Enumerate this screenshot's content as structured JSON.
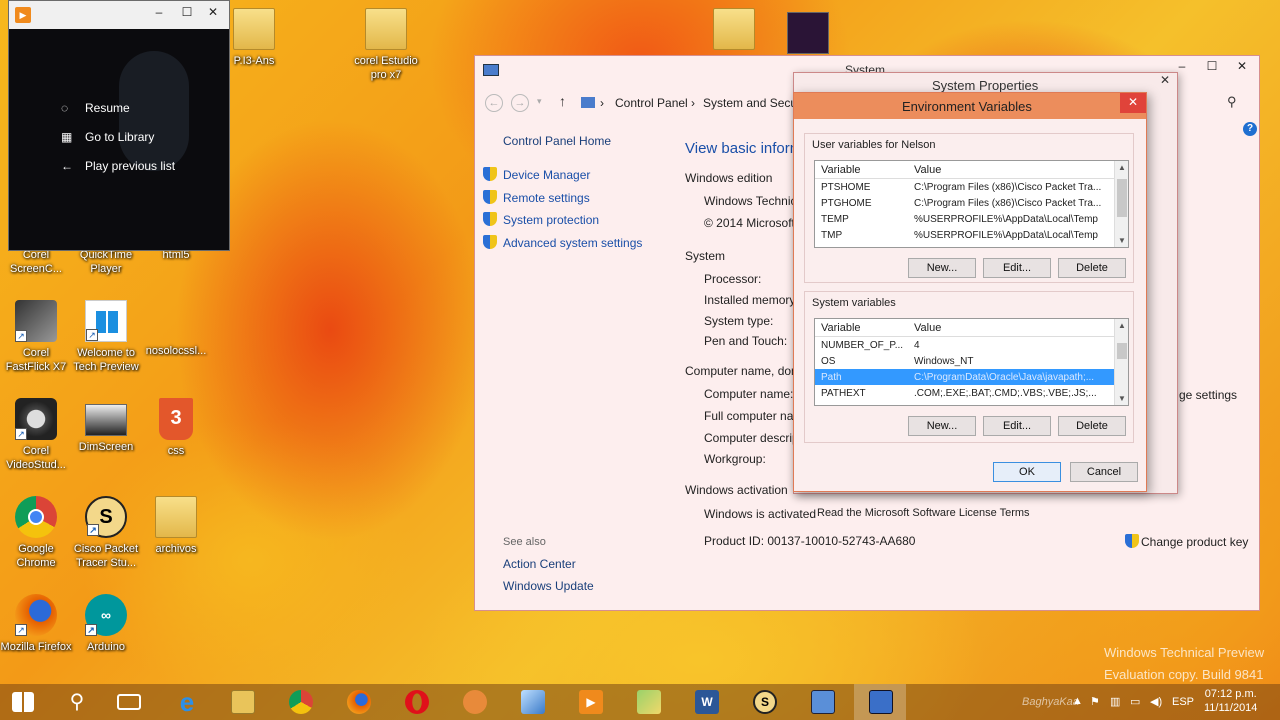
{
  "media_player": {
    "menu": [
      {
        "icon": "resume-icon",
        "label": "Resume"
      },
      {
        "icon": "library-icon",
        "label": "Go to Library"
      },
      {
        "icon": "back-arrow-icon",
        "label": "Play previous list"
      }
    ]
  },
  "desktop": {
    "icons": [
      {
        "name": "desktop-icon-p13-ans",
        "label": "P.I3-Ans"
      },
      {
        "name": "desktop-icon-corel-estudio",
        "label": "corel Estudio pro x7"
      },
      {
        "name": "desktop-icon-corel-screencap",
        "label": "Corel ScreenC..."
      },
      {
        "name": "desktop-icon-quicktime",
        "label": "QuickTime Player"
      },
      {
        "name": "desktop-icon-html5",
        "label": "html5"
      },
      {
        "name": "desktop-icon-corel-fastflick",
        "label": "Corel FastFlick X7"
      },
      {
        "name": "desktop-icon-welcome-tech-preview",
        "label": "Welcome to Tech Preview"
      },
      {
        "name": "desktop-icon-nosolocssl",
        "label": "nosolocssl..."
      },
      {
        "name": "desktop-icon-corel-videostudio",
        "label": "Corel VideoStud..."
      },
      {
        "name": "desktop-icon-dimscreen",
        "label": "DimScreen"
      },
      {
        "name": "desktop-icon-css",
        "label": "css"
      },
      {
        "name": "desktop-icon-google-chrome",
        "label": "Google Chrome"
      },
      {
        "name": "desktop-icon-cisco-packet-tracer",
        "label": "Cisco Packet Tracer Stu..."
      },
      {
        "name": "desktop-icon-archivos",
        "label": "archivos"
      },
      {
        "name": "desktop-icon-mozilla-firefox",
        "label": "Mozilla Firefox"
      },
      {
        "name": "desktop-icon-arduino",
        "label": "Arduino"
      }
    ]
  },
  "system_window": {
    "title": "System",
    "breadcrumb": [
      "Control Panel",
      "System and Securi"
    ],
    "left_nav": {
      "home": "Control Panel Home",
      "links": [
        "Device Manager",
        "Remote settings",
        "System protection",
        "Advanced system settings"
      ],
      "see_also": "See also",
      "see_also_links": [
        "Action Center",
        "Windows Update"
      ]
    },
    "heading": "View basic inform",
    "sections": {
      "edition": "Windows edition",
      "edition_name": "Windows Technica",
      "copyright": "© 2014 Microsoft",
      "system": "System",
      "processor": "Processor:",
      "memory": "Installed memory",
      "system_type": "System type:",
      "pen_touch": "Pen and Touch:",
      "computer_name_section": "Computer name, dom",
      "computer_name": "Computer name:",
      "full_computer_name": "Full computer nan",
      "computer_desc": "Computer descrip",
      "workgroup": "Workgroup:",
      "change_settings": "ge settings",
      "activation": "Windows activation",
      "activated": "Windows is activated",
      "license_link": "Read the Microsoft Software License Terms",
      "product_id": "Product ID: 00137-10010-52743-AA680",
      "change_key": "Change product key"
    },
    "watermark": [
      "Windows Technical Preview",
      "Evaluation copy. Build 9841"
    ]
  },
  "system_properties": {
    "title": "System Properties"
  },
  "env_dialog": {
    "title": "Environment Variables",
    "user_group_label": "User variables for Nelson",
    "system_group_label": "System variables",
    "col_variable": "Variable",
    "col_value": "Value",
    "user_vars": [
      {
        "name": "PTSHOME",
        "value": "C:\\Program Files (x86)\\Cisco Packet Tra..."
      },
      {
        "name": "PTGHOME",
        "value": "C:\\Program Files (x86)\\Cisco Packet Tra..."
      },
      {
        "name": "TEMP",
        "value": "%USERPROFILE%\\AppData\\Local\\Temp"
      },
      {
        "name": "TMP",
        "value": "%USERPROFILE%\\AppData\\Local\\Temp"
      }
    ],
    "system_vars": [
      {
        "name": "NUMBER_OF_P...",
        "value": "4"
      },
      {
        "name": "OS",
        "value": "Windows_NT"
      },
      {
        "name": "Path",
        "value": "C:\\ProgramData\\Oracle\\Java\\javapath;..."
      },
      {
        "name": "PATHEXT",
        "value": ".COM;.EXE;.BAT;.CMD;.VBS;.VBE;.JS;..."
      }
    ],
    "selected_system_var": "Path",
    "new_label": "New...",
    "edit_label": "Edit...",
    "delete_label": "Delete",
    "ok_label": "OK",
    "cancel_label": "Cancel"
  },
  "taskbar": {
    "items": [
      "start-button",
      "search-icon",
      "task-view-icon",
      "internet-explorer-icon",
      "file-explorer-icon",
      "chrome-icon",
      "firefox-icon",
      "opera-icon",
      "app-fist-icon",
      "cube-app-icon",
      "media-player-icon",
      "folder-app-icon",
      "word-icon",
      "packet-tracer-icon",
      "control-panel-icon",
      "system-window-icon"
    ],
    "language": "ESP",
    "time": "07:12 p.m.",
    "date": "11/11/2014",
    "user_tag": "BaghyaKaa"
  }
}
